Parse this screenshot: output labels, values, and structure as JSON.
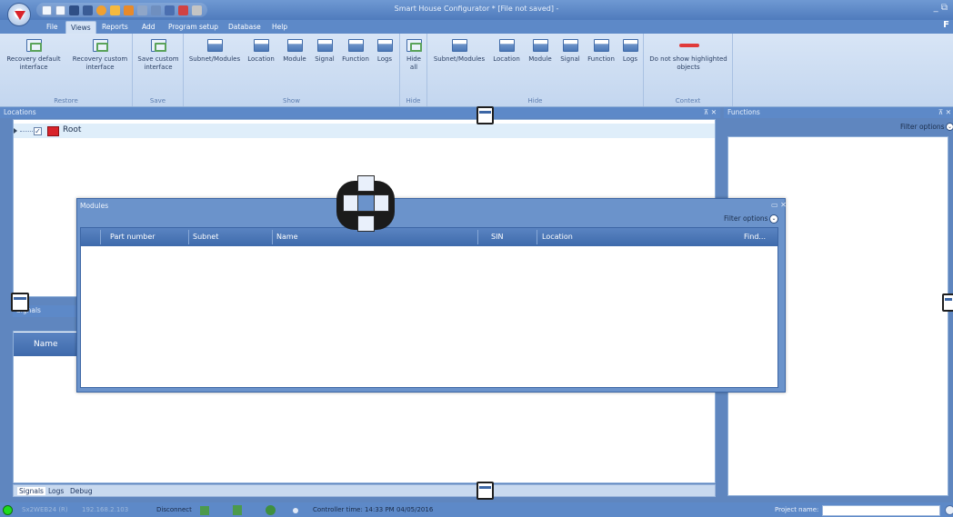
{
  "window": {
    "title": "Smart House Configurator * [File not saved] -",
    "controls": "_ ⧉",
    "ribbon_extra": "F"
  },
  "quick_access": [
    "new-icon",
    "open-icon",
    "save-icon",
    "save-as-icon",
    "refresh-icon",
    "import-icon",
    "export-icon",
    "network-icon",
    "tree-icon",
    "alert-icon",
    "shield-icon"
  ],
  "menu": [
    "File",
    "Views",
    "Reports",
    "Add",
    "Program setup",
    "Database",
    "Help"
  ],
  "menu_active": "Views",
  "ribbon": {
    "groups": [
      {
        "label": "Restore",
        "buttons": [
          {
            "line1": "Recovery default",
            "line2": "interface"
          },
          {
            "line1": "Recovery custom",
            "line2": "interface"
          }
        ]
      },
      {
        "label": "Save",
        "buttons": [
          {
            "line1": "Save custom",
            "line2": "interface"
          }
        ]
      },
      {
        "label": "Show",
        "buttons": [
          {
            "line1": "Subnet/Modules",
            "line2": ""
          },
          {
            "line1": "Location",
            "line2": ""
          },
          {
            "line1": "Module",
            "line2": ""
          },
          {
            "line1": "Signal",
            "line2": ""
          },
          {
            "line1": "Function",
            "line2": ""
          },
          {
            "line1": "Logs",
            "line2": ""
          }
        ]
      },
      {
        "label": "Hide",
        "buttons": [
          {
            "line1": "Hide",
            "line2": "all"
          }
        ]
      },
      {
        "label": "Hide",
        "buttons": [
          {
            "line1": "Subnet/Modules",
            "line2": ""
          },
          {
            "line1": "Location",
            "line2": ""
          },
          {
            "line1": "Module",
            "line2": ""
          },
          {
            "line1": "Signal",
            "line2": ""
          },
          {
            "line1": "Function",
            "line2": ""
          },
          {
            "line1": "Logs",
            "line2": ""
          }
        ]
      },
      {
        "label": "Context",
        "buttons": [
          {
            "line1": "Do not show highlighted",
            "line2": "objects"
          }
        ]
      }
    ]
  },
  "locations": {
    "title": "Locations",
    "pin": "⊼ ✕",
    "root_label": "Root",
    "root_checked": true
  },
  "signals": {
    "title": "Signals",
    "column": "Name",
    "tabs": [
      "Signals",
      "Logs",
      "Debug"
    ]
  },
  "functions": {
    "title": "Functions",
    "pin": "⊼ ✕",
    "filter": "Filter options"
  },
  "modules": {
    "title": "Modules",
    "close": "▭ ✕",
    "filter": "Filter options",
    "columns": [
      "Part number",
      "Subnet",
      "Name",
      "SIN",
      "Location",
      "Find..."
    ]
  },
  "statusbar": {
    "led_color": "#1edb1e",
    "device": "Sx2WEB24 (R)",
    "ip": "192.168.2.103",
    "disconnect": "Disconnect",
    "controller_time": "Controller time: 14:33 PM 04/05/2016",
    "project_label": "Project name:",
    "project_value": ""
  }
}
